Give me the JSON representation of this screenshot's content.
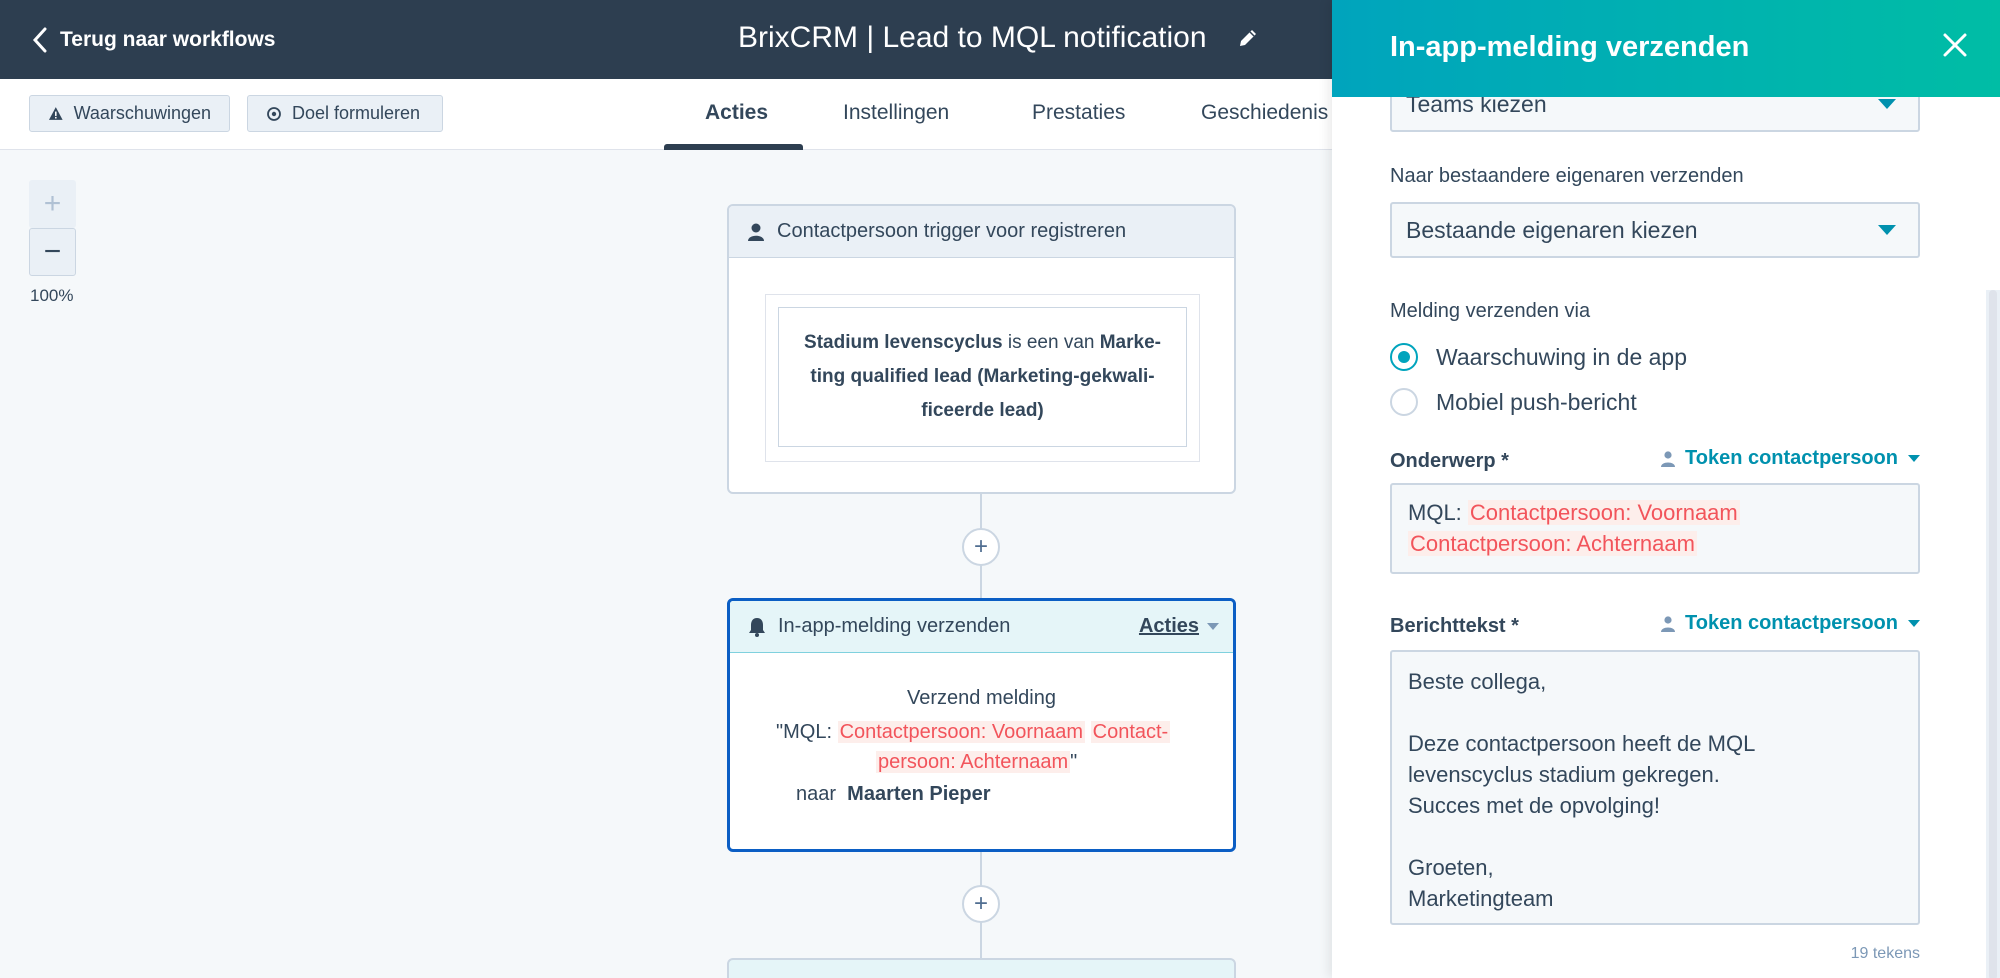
{
  "topbar": {
    "back_label": "Terug naar workflows",
    "workflow_title": "BrixCRM | Lead to MQL notification"
  },
  "subnav": {
    "warnings_label": "Waarschuwingen",
    "goal_label": "Doel formuleren",
    "tabs": [
      {
        "label": "Acties",
        "active": true
      },
      {
        "label": "Instellingen",
        "active": false
      },
      {
        "label": "Prestaties",
        "active": false
      },
      {
        "label": "Geschiedenis",
        "active": false
      }
    ]
  },
  "zoom": {
    "in_label": "+",
    "out_label": "−",
    "level": "100%"
  },
  "trigger": {
    "header": "Contactpersoon trigger voor registreren",
    "filter_prop": "Stadium levenscyclus",
    "filter_op": " is een van ",
    "filter_line1_val": "Marke-",
    "filter_line2": "ting qualified lead (Marketing-gekwali-",
    "filter_line3": "ficeerde lead)"
  },
  "action": {
    "header": "In-app-melding verzenden",
    "menu_label": "Acties",
    "title": "Verzend melding",
    "quote_open": "\"MQL: ",
    "token_firstname": "Contactpersoon: Voornaam",
    "token_lastname_part1": "Contact-",
    "token_lastname_part2": "persoon: Achternaam",
    "quote_close": "\"",
    "to_label": "naar",
    "recipient": "Maarten Pieper"
  },
  "panel": {
    "title": "In-app-melding verzenden",
    "teams_placeholder": "Teams kiezen",
    "owners_label": "Naar bestaandere eigenaren verzenden",
    "owners_placeholder": "Bestaande eigenaren kiezen",
    "send_via_label": "Melding verzenden via",
    "options": [
      {
        "label": "Waarschuwing in de app",
        "selected": true
      },
      {
        "label": "Mobiel push-bericht",
        "selected": false
      }
    ],
    "subject_label": "Onderwerp *",
    "token_link": "Token contactpersoon",
    "subject_prefix": "MQL: ",
    "subject_token1": "Contactpersoon: Voornaam",
    "subject_token2": "Contactpersoon: Achternaam",
    "body_label": "Berichttekst *",
    "body_lines": [
      "Beste collega,",
      "",
      "Deze contactpersoon heeft de MQL",
      "levenscyclus stadium gekregen.",
      "Succes met de opvolging!",
      "",
      "Groeten,",
      "Marketingteam"
    ],
    "char_count": "19 tekens"
  },
  "colors": {
    "topbar_bg": "#2d3e50",
    "panel_header_from": "#00a4bd",
    "panel_header_to": "#00bda5",
    "token_text": "#f2545b",
    "token_bg": "#fdeeeb",
    "link_teal": "#0091ae",
    "selected_card_border": "#0b5ec4"
  }
}
